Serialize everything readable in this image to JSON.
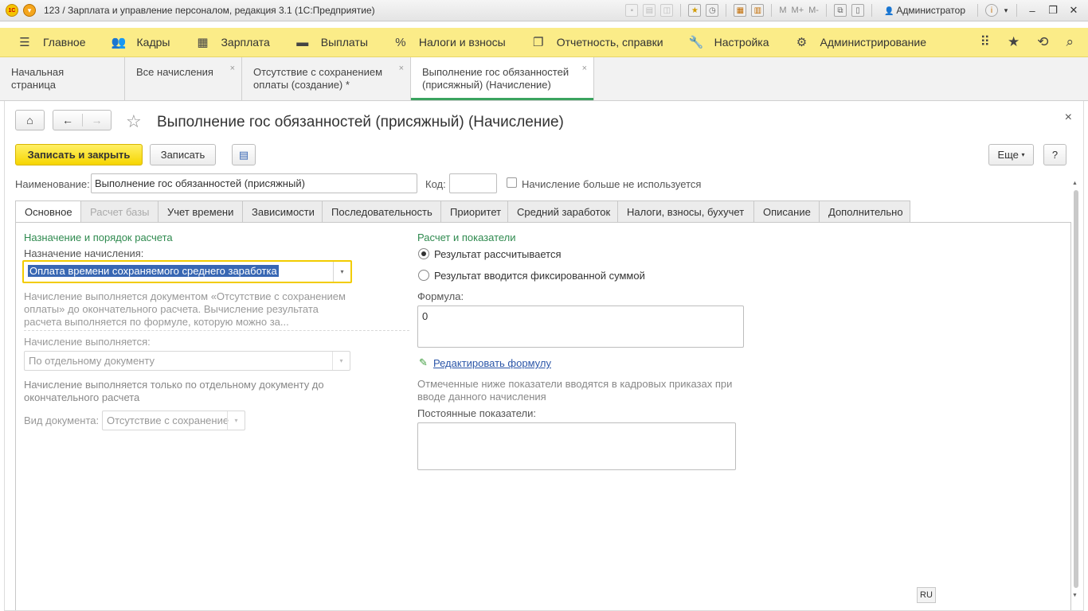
{
  "window": {
    "title": "123 / Зарплата и управление персоналом, редакция 3.1  (1С:Предприятие)",
    "logo_text": "1С",
    "user": "Администратор",
    "tb_m": "M",
    "tb_mplus": "M+",
    "tb_mminus": "M-"
  },
  "sections": [
    {
      "label": "Главное",
      "icon": "hamburger-icon"
    },
    {
      "label": "Кадры",
      "icon": "people-icon"
    },
    {
      "label": "Зарплата",
      "icon": "calculator-icon"
    },
    {
      "label": "Выплаты",
      "icon": "wallet-icon"
    },
    {
      "label": "Налоги и взносы",
      "icon": "percent-icon"
    },
    {
      "label": "Отчетность, справки",
      "icon": "documents-icon"
    },
    {
      "label": "Настройка",
      "icon": "wrench-icon"
    },
    {
      "label": "Администрирование",
      "icon": "gear-icon"
    }
  ],
  "open_tabs": [
    {
      "label": "Начальная страница"
    },
    {
      "label": "Все начисления"
    },
    {
      "label": "Отсутствие с сохранением оплаты (создание) *"
    },
    {
      "label": "Выполнение гос обязанностей (присяжный) (Начисление)"
    }
  ],
  "form": {
    "title": "Выполнение гос обязанностей (присяжный) (Начисление)",
    "btn_save_close": "Записать и закрыть",
    "btn_save": "Записать",
    "btn_more": "Еще",
    "btn_help": "?",
    "name_label": "Наименование:",
    "name_value": "Выполнение гос обязанностей (присяжный)",
    "code_label": "Код:",
    "code_value": "",
    "unused_label": "Начисление больше не используется",
    "tabs": [
      "Основное",
      "Расчет базы",
      "Учет времени",
      "Зависимости",
      "Последовательность",
      "Приоритет",
      "Средний заработок",
      "Налоги, взносы, бухучет",
      "Описание",
      "Дополнительно"
    ],
    "left": {
      "section_title": "Назначение и порядок расчета",
      "purpose_label": "Назначение начисления:",
      "purpose_value": "Оплата времени сохраняемого среднего заработка",
      "purpose_hint": "Начисление выполняется документом «Отсутствие с сохранением оплаты» до окончательного расчета. Вычисление результата расчета выполняется по формуле, которую можно за...",
      "performed_label": "Начисление выполняется:",
      "performed_value": "По отдельному документу",
      "performed_hint": "Начисление выполняется только по отдельному документу до окончательного расчета",
      "doc_type_label": "Вид документа:",
      "doc_type_value": "Отсутствие с сохранение"
    },
    "right": {
      "section_title": "Расчет и показатели",
      "radio_calc": "Результат рассчитывается",
      "radio_fixed": "Результат вводится фиксированной суммой",
      "formula_label": "Формула:",
      "formula_value": "0",
      "edit_formula": "Редактировать формулу",
      "indicators_hint": "Отмеченные ниже показатели вводятся в кадровых приказах при вводе данного начисления",
      "constant_label": "Постоянные показатели:"
    }
  },
  "status": {
    "lang": "RU"
  }
}
